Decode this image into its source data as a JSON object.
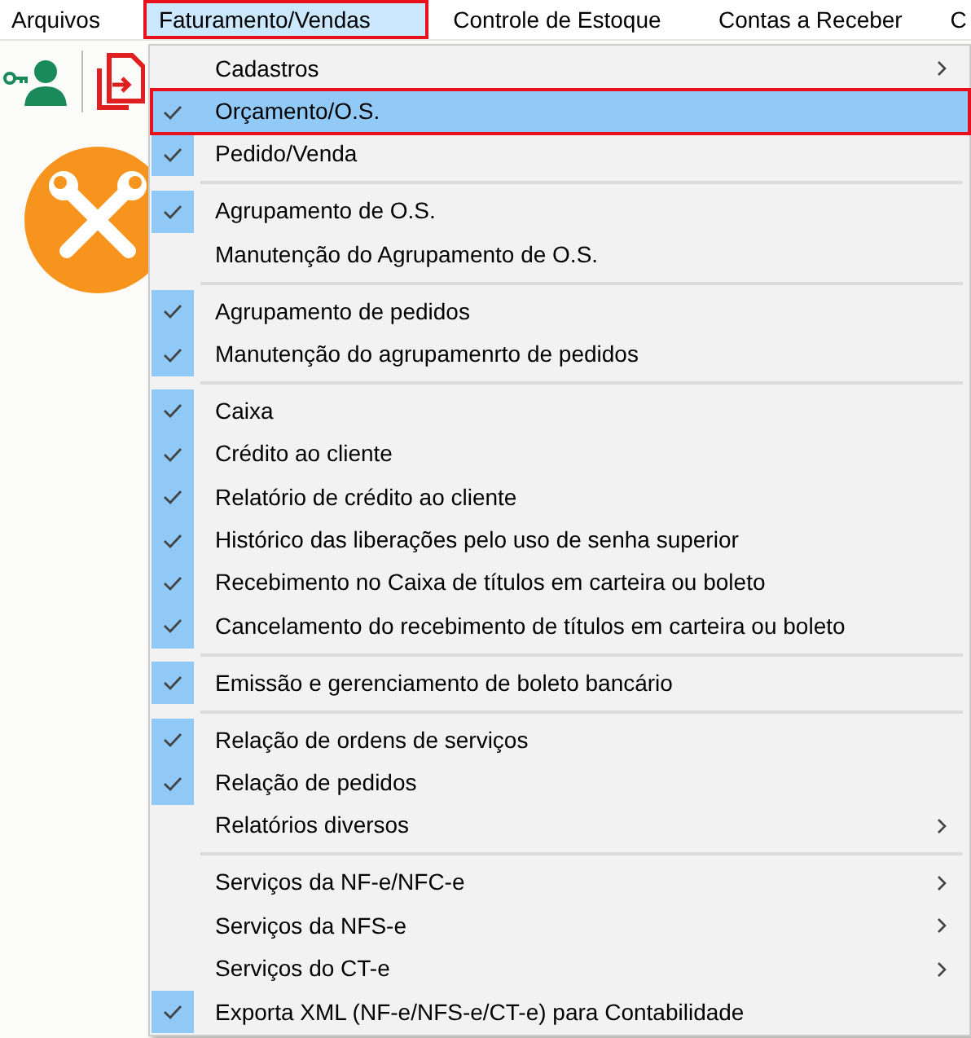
{
  "menubar": [
    {
      "label": "Arquivos",
      "selected": false
    },
    {
      "label": "Faturamento/Vendas",
      "selected": true
    },
    {
      "label": "Controle de Estoque",
      "selected": false
    },
    {
      "label": "Contas a Receber",
      "selected": false
    },
    {
      "label": "C",
      "selected": false
    }
  ],
  "menu": {
    "groups": [
      [
        {
          "label": "Cadastros",
          "checked": false,
          "submenu": true,
          "selected": false
        },
        {
          "label": "Orçamento/O.S.",
          "checked": true,
          "submenu": false,
          "selected": true
        },
        {
          "label": "Pedido/Venda",
          "checked": true,
          "submenu": false,
          "selected": false
        }
      ],
      [
        {
          "label": "Agrupamento de O.S.",
          "checked": true,
          "submenu": false,
          "selected": false
        },
        {
          "label": "Manutenção do Agrupamento de O.S.",
          "checked": false,
          "submenu": false,
          "selected": false
        }
      ],
      [
        {
          "label": "Agrupamento de pedidos",
          "checked": true,
          "submenu": false,
          "selected": false
        },
        {
          "label": "Manutenção do agrupamenrto de pedidos",
          "checked": true,
          "submenu": false,
          "selected": false
        }
      ],
      [
        {
          "label": "Caixa",
          "checked": true,
          "submenu": false,
          "selected": false
        },
        {
          "label": "Crédito ao cliente",
          "checked": true,
          "submenu": false,
          "selected": false
        },
        {
          "label": "Relatório de crédito ao cliente",
          "checked": true,
          "submenu": false,
          "selected": false
        },
        {
          "label": "Histórico das liberações pelo uso de senha superior",
          "checked": true,
          "submenu": false,
          "selected": false
        },
        {
          "label": "Recebimento no Caixa de títulos em carteira ou boleto",
          "checked": true,
          "submenu": false,
          "selected": false
        },
        {
          "label": "Cancelamento do recebimento de títulos em carteira ou boleto",
          "checked": true,
          "submenu": false,
          "selected": false
        }
      ],
      [
        {
          "label": "Emissão e gerenciamento de boleto bancário",
          "checked": true,
          "submenu": false,
          "selected": false
        }
      ],
      [
        {
          "label": "Relação de ordens de serviços",
          "checked": true,
          "submenu": false,
          "selected": false
        },
        {
          "label": "Relação de pedidos",
          "checked": true,
          "submenu": false,
          "selected": false
        },
        {
          "label": "Relatórios diversos",
          "checked": false,
          "submenu": true,
          "selected": false
        }
      ],
      [
        {
          "label": "Serviços da NF-e/NFC-e",
          "checked": false,
          "submenu": true,
          "selected": false
        },
        {
          "label": "Serviços da NFS-e",
          "checked": false,
          "submenu": true,
          "selected": false
        },
        {
          "label": "Serviços do CT-e",
          "checked": false,
          "submenu": true,
          "selected": false
        },
        {
          "label": "Exporta XML (NF-e/NFS-e/CT-e) para Contabilidade",
          "checked": true,
          "submenu": false,
          "selected": false
        }
      ]
    ]
  }
}
